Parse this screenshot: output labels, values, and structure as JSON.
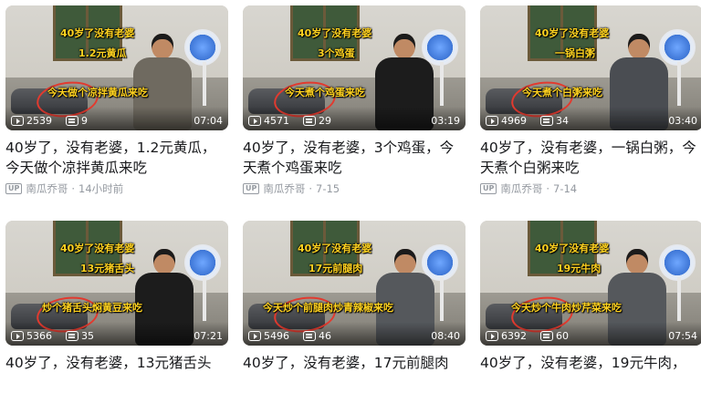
{
  "colors": {
    "overlay_text": "#ffd21f",
    "title": "#18191c",
    "meta": "#9499a0"
  },
  "videos": [
    {
      "overlay_top": "40岁了没有老婆",
      "overlay_mid": "1.2元黄瓜",
      "overlay_low": "今天做个凉拌黄瓜来吃",
      "plays": "2539",
      "danmaku": "9",
      "duration": "07:04",
      "title": "40岁了，没有老婆，1.2元黄瓜，今天做个凉拌黄瓜来吃",
      "uploader": "南瓜乔哥",
      "date": "14小时前",
      "shirt": "#6f6a60"
    },
    {
      "overlay_top": "40岁了没有老婆",
      "overlay_mid": "3个鸡蛋",
      "overlay_low": "今天煮个鸡蛋来吃",
      "plays": "4571",
      "danmaku": "29",
      "duration": "03:19",
      "title": "40岁了，没有老婆，3个鸡蛋，今天煮个鸡蛋来吃",
      "uploader": "南瓜乔哥",
      "date": "7-15",
      "shirt": "#1c1c1c"
    },
    {
      "overlay_top": "40岁了没有老婆",
      "overlay_mid": "一锅白粥",
      "overlay_low": "今天煮个白粥来吃",
      "plays": "4969",
      "danmaku": "34",
      "duration": "03:40",
      "title": "40岁了，没有老婆，一锅白粥，今天煮个白粥来吃",
      "uploader": "南瓜乔哥",
      "date": "7-14",
      "shirt": "#4a4d52"
    },
    {
      "overlay_top": "40岁了没有老婆",
      "overlay_mid": "13元猪舌头",
      "overlay_low": "炒个猪舌头焖黄豆来吃",
      "plays": "5366",
      "danmaku": "35",
      "duration": "07:21",
      "title": "40岁了，没有老婆，13元猪舌头",
      "uploader": "",
      "date": "",
      "shirt": "#1c1c1c"
    },
    {
      "overlay_top": "40岁了没有老婆",
      "overlay_mid": "17元前腿肉",
      "overlay_low": "今天炒个前腿肉炒青辣椒来吃",
      "plays": "5496",
      "danmaku": "46",
      "duration": "08:40",
      "title": "40岁了，没有老婆，17元前腿肉",
      "uploader": "",
      "date": "",
      "shirt": "#55585c"
    },
    {
      "overlay_top": "40岁了没有老婆",
      "overlay_mid": "19元牛肉",
      "overlay_low": "今天炒个牛肉炒芹菜来吃",
      "plays": "6392",
      "danmaku": "60",
      "duration": "07:54",
      "title": "40岁了，没有老婆，19元牛肉，",
      "uploader": "",
      "date": "",
      "shirt": "#55585c"
    }
  ]
}
